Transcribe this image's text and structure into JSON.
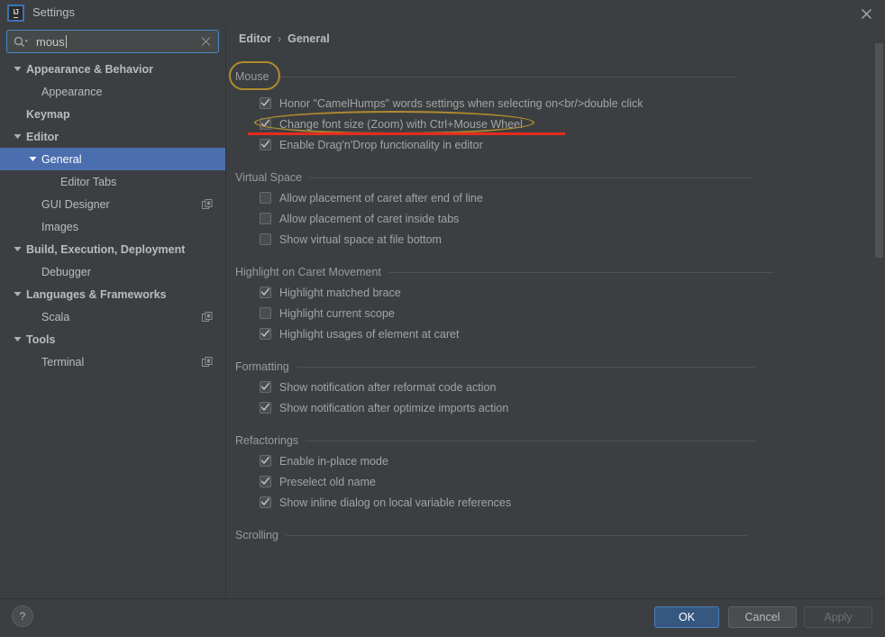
{
  "window": {
    "title": "Settings",
    "logo_text": "IJ",
    "close_icon": "close-icon"
  },
  "search": {
    "value": "mous",
    "placeholder": "",
    "icon": "search-icon",
    "clear_icon": "close-icon"
  },
  "sidebar": {
    "items": [
      {
        "label": "Appearance & Behavior",
        "indent": 0,
        "bold": true,
        "twisty": "down",
        "selected": false,
        "scope_icon": false
      },
      {
        "label": "Appearance",
        "indent": 1,
        "bold": false,
        "twisty": "none",
        "selected": false,
        "scope_icon": false
      },
      {
        "label": "Keymap",
        "indent": 0,
        "bold": true,
        "twisty": "none",
        "selected": false,
        "scope_icon": false
      },
      {
        "label": "Editor",
        "indent": 0,
        "bold": true,
        "twisty": "down",
        "selected": false,
        "scope_icon": false
      },
      {
        "label": "General",
        "indent": 1,
        "bold": false,
        "twisty": "down",
        "selected": true,
        "scope_icon": false
      },
      {
        "label": "Editor Tabs",
        "indent": 2,
        "bold": false,
        "twisty": "none",
        "selected": false,
        "scope_icon": false
      },
      {
        "label": "GUI Designer",
        "indent": 1,
        "bold": false,
        "twisty": "none",
        "selected": false,
        "scope_icon": true
      },
      {
        "label": "Images",
        "indent": 1,
        "bold": false,
        "twisty": "none",
        "selected": false,
        "scope_icon": false
      },
      {
        "label": "Build, Execution, Deployment",
        "indent": 0,
        "bold": true,
        "twisty": "down",
        "selected": false,
        "scope_icon": false
      },
      {
        "label": "Debugger",
        "indent": 1,
        "bold": false,
        "twisty": "none",
        "selected": false,
        "scope_icon": false
      },
      {
        "label": "Languages & Frameworks",
        "indent": 0,
        "bold": true,
        "twisty": "down",
        "selected": false,
        "scope_icon": false
      },
      {
        "label": "Scala",
        "indent": 1,
        "bold": false,
        "twisty": "none",
        "selected": false,
        "scope_icon": true
      },
      {
        "label": "Tools",
        "indent": 0,
        "bold": true,
        "twisty": "down",
        "selected": false,
        "scope_icon": false
      },
      {
        "label": "Terminal",
        "indent": 1,
        "bold": false,
        "twisty": "none",
        "selected": false,
        "scope_icon": true
      }
    ]
  },
  "breadcrumb": {
    "root": "Editor",
    "separator": "›",
    "leaf": "General"
  },
  "main": {
    "groups": [
      {
        "title": "Mouse",
        "rule_width": 510,
        "highlighted": true,
        "options": [
          {
            "label": "Honor \"CamelHumps\" words settings when selecting on<br/>double click",
            "checked": true,
            "annotated": false
          },
          {
            "label": "Change font size (Zoom) with Ctrl+Mouse Wheel",
            "checked": true,
            "annotated": true
          },
          {
            "label": "Enable Drag'n'Drop functionality in editor",
            "checked": true,
            "annotated": false
          }
        ]
      },
      {
        "title": "Virtual Space",
        "rule_width": 492,
        "highlighted": false,
        "options": [
          {
            "label": "Allow placement of caret after end of line",
            "checked": false,
            "annotated": false
          },
          {
            "label": "Allow placement of caret inside tabs",
            "checked": false,
            "annotated": false
          },
          {
            "label": "Show virtual space at file bottom",
            "checked": false,
            "annotated": false
          }
        ]
      },
      {
        "title": "Highlight on Caret Movement",
        "rule_width": 428,
        "highlighted": false,
        "options": [
          {
            "label": "Highlight matched brace",
            "checked": true,
            "annotated": false
          },
          {
            "label": "Highlight current scope",
            "checked": false,
            "annotated": false
          },
          {
            "label": "Highlight usages of element at caret",
            "checked": true,
            "annotated": false
          }
        ]
      },
      {
        "title": "Formatting",
        "rule_width": 508,
        "highlighted": false,
        "options": [
          {
            "label": "Show notification after reformat code action",
            "checked": true,
            "annotated": false
          },
          {
            "label": "Show notification after optimize imports action",
            "checked": true,
            "annotated": false
          }
        ]
      },
      {
        "title": "Refactorings",
        "rule_width": 500,
        "highlighted": false,
        "options": [
          {
            "label": "Enable in-place mode",
            "checked": true,
            "annotated": false
          },
          {
            "label": "Preselect old name",
            "checked": true,
            "annotated": false
          },
          {
            "label": "Show inline dialog on local variable references",
            "checked": true,
            "annotated": false
          }
        ]
      },
      {
        "title": "Scrolling",
        "rule_width": 512,
        "highlighted": false,
        "options": []
      }
    ]
  },
  "footer": {
    "help_label": "?",
    "ok_label": "OK",
    "cancel_label": "Cancel",
    "apply_label": "Apply"
  },
  "colors": {
    "background": "#3c3f41",
    "selection_blue": "#4b6eaf",
    "accent_blue": "#4a88c7",
    "ok_button": "#365880",
    "annotation_gold": "#b08a30",
    "annotation_red": "#e62b1e",
    "text_primary": "#bbbbbb",
    "text_dim": "#9a9a9a"
  }
}
